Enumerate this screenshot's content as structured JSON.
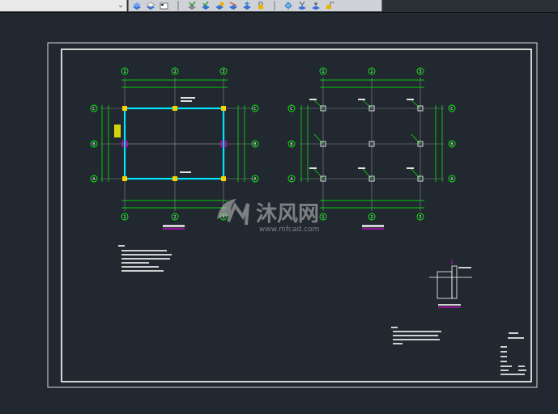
{
  "toolbar": {
    "dropdown_icon": "chevron-down-icon",
    "icons": [
      "layer-icon",
      "layer-icon",
      "layer-props-icon",
      "separator",
      "match-icon",
      "layer-on-icon",
      "layer-off-icon",
      "layer-isolate-icon",
      "layer-freeze-icon",
      "layer-lock-icon",
      "separator",
      "layer-walk-icon",
      "layer-merge-icon",
      "layer-delete-icon",
      "layer-unlock-icon"
    ]
  },
  "drawing": {
    "colors": {
      "background": "#212830",
      "frame": "#ffffff",
      "axis": "#00ff00",
      "beam": "#00e5ff",
      "grid": "#8a8a8a",
      "magenta": "#ff00ff",
      "yellow": "#ffff00"
    },
    "grid_labels": {
      "left_plan_top": [
        "1",
        "2",
        "3"
      ],
      "left_plan_side": [
        "C",
        "B",
        "A"
      ],
      "right_plan_top": [
        "1",
        "2",
        "3"
      ],
      "right_plan_side": [
        "C",
        "B",
        "A"
      ]
    },
    "watermark": {
      "brand": "沐风网",
      "url": "www.mfcad.com"
    }
  }
}
